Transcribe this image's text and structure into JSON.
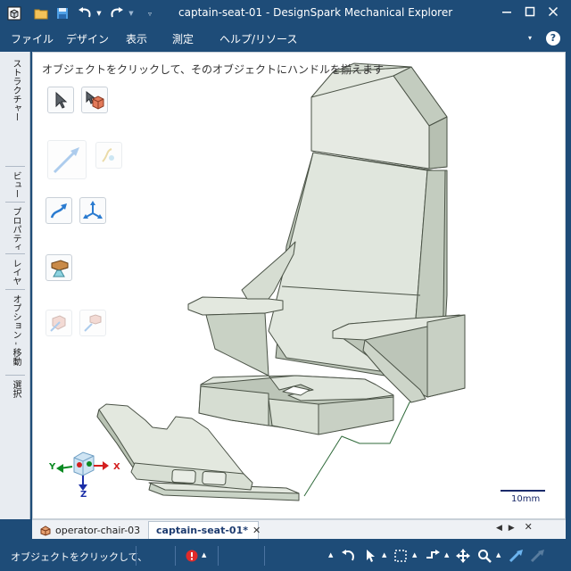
{
  "window": {
    "title": "captain-seat-01 - DesignSpark Mechanical Explorer"
  },
  "menu": {
    "items": [
      "ファイル",
      "デザイン",
      "表示",
      "測定",
      "ヘルプ/リソース"
    ]
  },
  "side_tabs": [
    "ストラクチャー",
    "ビュー",
    "プロパティ",
    "レイヤ",
    "オプション - 移動",
    "選択"
  ],
  "viewport": {
    "hint": "オブジェクトをクリックして、そのオブジェクトにハンドルを揃えます",
    "scale_label": "10mm"
  },
  "triad": {
    "y_label": "Y",
    "x_label": "X",
    "z_label": "Z"
  },
  "document_tabs": [
    {
      "label": "operator-chair-03",
      "active": false
    },
    {
      "label": "captain-seat-01*",
      "active": true
    }
  ],
  "status": {
    "message": "オブジェクトをクリックして、"
  },
  "colors": {
    "chrome": "#1e4c78",
    "model_face": "#dfe5dc",
    "model_edge": "#4a5246"
  },
  "icons": [
    "app-icon",
    "open-folder-icon",
    "save-icon",
    "undo-icon",
    "redo-icon",
    "customize-icon",
    "minimize-icon",
    "maximize-icon",
    "close-icon",
    "help-icon",
    "select-tool-icon",
    "select-component-icon",
    "pull-tool-icon",
    "move-tool-icon",
    "error-icon"
  ]
}
